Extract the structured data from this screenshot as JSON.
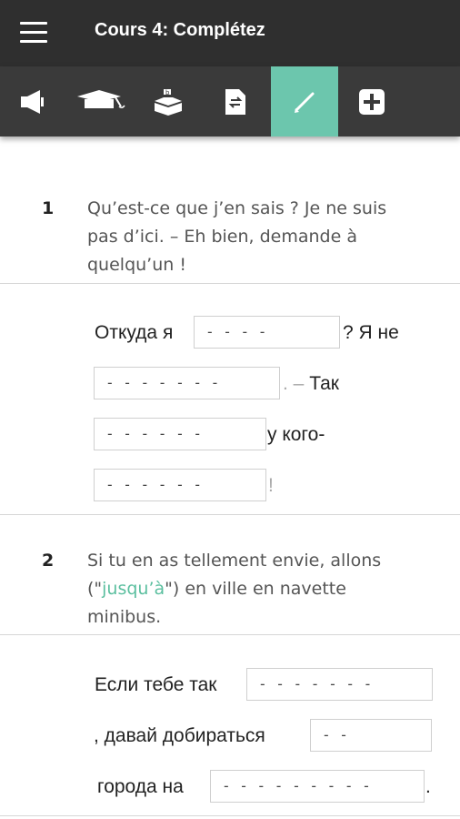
{
  "header": {
    "title": "Cours 4: Complétez"
  },
  "toolbar": {
    "items": [
      {
        "icon": "megaphone-icon"
      },
      {
        "icon": "graduation-cap-icon"
      },
      {
        "icon": "stamp-icon"
      },
      {
        "icon": "swap-document-icon"
      },
      {
        "icon": "pencil-icon",
        "active": true
      },
      {
        "icon": "plus-icon"
      }
    ],
    "active_color": "#6cc6ad"
  },
  "exercises": [
    {
      "number": "1",
      "french_l1": "Qu’est-ce que j’en sais ? Je ne suis",
      "french_l2": "pas d’ici. – Eh bien, demande à",
      "french_l3": "quelqu’un !",
      "ru_1": "Откуда я",
      "gap_1": "- - - -",
      "ru_2": "? Я не",
      "gap_2": "- - - - - - -",
      "ru_3_punct": ". –",
      "ru_3": "Так",
      "gap_3": "- - - - - -",
      "ru_4": "у кого-",
      "gap_4": "- - - - - -",
      "ru_5": "!"
    },
    {
      "number": "2",
      "french_l1": "Si tu en as tellement envie, allons",
      "french_l2_pre": "(\"",
      "french_l2_hl": "jusqu’à",
      "french_l2_post": "\") en ville en navette",
      "french_l3": "minibus.",
      "ru_1": "Если тебе так",
      "gap_1": "- - - - - - -",
      "ru_2": ", давай добираться",
      "gap_2": "- -",
      "ru_3": "города на",
      "gap_3": "- - - - - - - - -",
      "ru_4": "."
    }
  ]
}
